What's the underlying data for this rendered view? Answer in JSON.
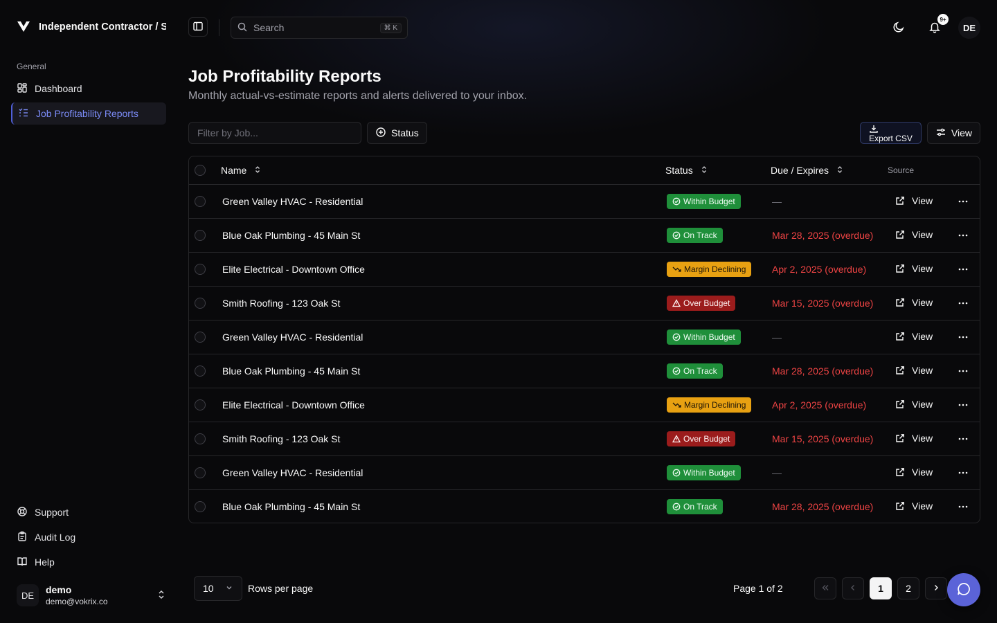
{
  "brand": {
    "title": "Independent Contractor / S"
  },
  "sidebar": {
    "group_label": "General",
    "items": [
      {
        "label": "Dashboard",
        "icon": "dashboard-icon",
        "active": false
      },
      {
        "label": "Job Profitability Reports",
        "icon": "list-checks-icon",
        "active": true
      }
    ],
    "footer_items": [
      {
        "label": "Support",
        "icon": "life-buoy-icon"
      },
      {
        "label": "Audit Log",
        "icon": "clipboard-icon"
      },
      {
        "label": "Help",
        "icon": "book-icon"
      }
    ],
    "user": {
      "initials": "DE",
      "name": "demo",
      "email": "demo@vokrix.co"
    }
  },
  "topbar": {
    "search_placeholder": "Search",
    "search_shortcut": "⌘ K",
    "notification_count": "9+",
    "avatar_initials": "DE"
  },
  "header": {
    "title": "Job Profitability Reports",
    "subtitle": "Monthly actual-vs-estimate reports and alerts delivered to your inbox."
  },
  "toolbar": {
    "filter_placeholder": "Filter by Job...",
    "status_label": "Status",
    "export_label": "Export CSV",
    "view_label": "View"
  },
  "table": {
    "columns": {
      "name": "Name",
      "status": "Status",
      "due": "Due / Expires",
      "source": "Source"
    },
    "rows": [
      {
        "name": "Green Valley HVAC - Residential",
        "status": "Within Budget",
        "status_kind": "within",
        "due": "—",
        "due_kind": "none",
        "action": "View"
      },
      {
        "name": "Blue Oak Plumbing - 45 Main St",
        "status": "On Track",
        "status_kind": "ontrack",
        "due": "Mar 28, 2025 (overdue)",
        "due_kind": "overdue",
        "action": "View"
      },
      {
        "name": "Elite Electrical - Downtown Office",
        "status": "Margin Declining",
        "status_kind": "margin",
        "due": "Apr 2, 2025 (overdue)",
        "due_kind": "overdue",
        "action": "View"
      },
      {
        "name": "Smith Roofing - 123 Oak St",
        "status": "Over Budget",
        "status_kind": "over",
        "due": "Mar 15, 2025 (overdue)",
        "due_kind": "overdue",
        "action": "View"
      },
      {
        "name": "Green Valley HVAC - Residential",
        "status": "Within Budget",
        "status_kind": "within",
        "due": "—",
        "due_kind": "none",
        "action": "View"
      },
      {
        "name": "Blue Oak Plumbing - 45 Main St",
        "status": "On Track",
        "status_kind": "ontrack",
        "due": "Mar 28, 2025 (overdue)",
        "due_kind": "overdue",
        "action": "View"
      },
      {
        "name": "Elite Electrical - Downtown Office",
        "status": "Margin Declining",
        "status_kind": "margin",
        "due": "Apr 2, 2025 (overdue)",
        "due_kind": "overdue",
        "action": "View"
      },
      {
        "name": "Smith Roofing - 123 Oak St",
        "status": "Over Budget",
        "status_kind": "over",
        "due": "Mar 15, 2025 (overdue)",
        "due_kind": "overdue",
        "action": "View"
      },
      {
        "name": "Green Valley HVAC - Residential",
        "status": "Within Budget",
        "status_kind": "within",
        "due": "—",
        "due_kind": "none",
        "action": "View"
      },
      {
        "name": "Blue Oak Plumbing - 45 Main St",
        "status": "On Track",
        "status_kind": "ontrack",
        "due": "Mar 28, 2025 (overdue)",
        "due_kind": "overdue",
        "action": "View"
      }
    ]
  },
  "pagination": {
    "rows_per_page_value": "10",
    "rows_per_page_label": "Rows per page",
    "page_info": "Page 1 of 2",
    "pages": [
      "1",
      "2"
    ],
    "current_page": "1"
  },
  "colors": {
    "accent": "#5b63d8",
    "within": "#1f8f3a",
    "margin": "#e8a112",
    "over": "#9b1c1c",
    "overdue_text": "#ef4444"
  }
}
